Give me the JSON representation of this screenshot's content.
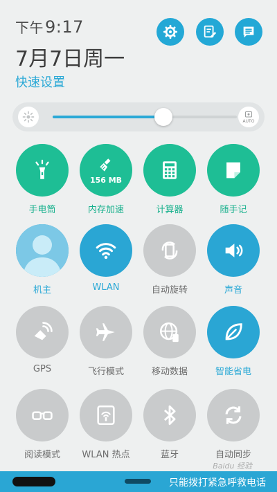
{
  "status": {
    "ampm": "下午",
    "time": "9:17",
    "date": "7月7日周一",
    "quick_settings_title": "快速设置"
  },
  "header_icons": [
    "gear-icon",
    "edit-note-icon",
    "notification-list-icon"
  ],
  "brightness": {
    "level_percent": 60,
    "auto_label": "AUTO"
  },
  "tiles": [
    {
      "id": "flashlight",
      "label": "手电筒",
      "state": "on-green",
      "icon": "flashlight-icon"
    },
    {
      "id": "boost",
      "label": "内存加速",
      "state": "on-green",
      "icon": "broom-icon",
      "value": "156 MB"
    },
    {
      "id": "calculator",
      "label": "计算器",
      "state": "on-green",
      "icon": "calculator-icon"
    },
    {
      "id": "quick-memo",
      "label": "随手记",
      "state": "on-green",
      "icon": "memo-icon"
    },
    {
      "id": "owner",
      "label": "机主",
      "state": "on",
      "icon": "user-avatar-icon"
    },
    {
      "id": "wlan",
      "label": "WLAN",
      "state": "on",
      "icon": "wifi-icon"
    },
    {
      "id": "auto-rotate",
      "label": "自动旋转",
      "state": "off",
      "icon": "rotate-icon"
    },
    {
      "id": "sound",
      "label": "声音",
      "state": "on",
      "icon": "speaker-icon"
    },
    {
      "id": "gps",
      "label": "GPS",
      "state": "off",
      "icon": "gps-icon"
    },
    {
      "id": "airplane",
      "label": "飞行模式",
      "state": "off",
      "icon": "airplane-icon"
    },
    {
      "id": "mobile-data",
      "label": "移动数据",
      "state": "off",
      "icon": "globe-data-icon"
    },
    {
      "id": "power-saving",
      "label": "智能省电",
      "state": "on",
      "icon": "leaf-icon"
    },
    {
      "id": "reading-mode",
      "label": "阅读模式",
      "state": "off",
      "icon": "glasses-icon"
    },
    {
      "id": "hotspot",
      "label": "WLAN 热点",
      "state": "off",
      "icon": "hotspot-icon"
    },
    {
      "id": "bluetooth",
      "label": "蓝牙",
      "state": "off",
      "icon": "bluetooth-icon"
    },
    {
      "id": "auto-sync",
      "label": "自动同步",
      "state": "off",
      "icon": "sync-icon"
    }
  ],
  "bottom_bar": {
    "emergency_text": "只能拨打紧急呼救电话"
  },
  "watermark": "Baidu 经验",
  "colors": {
    "accent_blue": "#2aa6d4",
    "accent_green": "#1ebe95",
    "inactive_grey": "#c9cbcc"
  }
}
